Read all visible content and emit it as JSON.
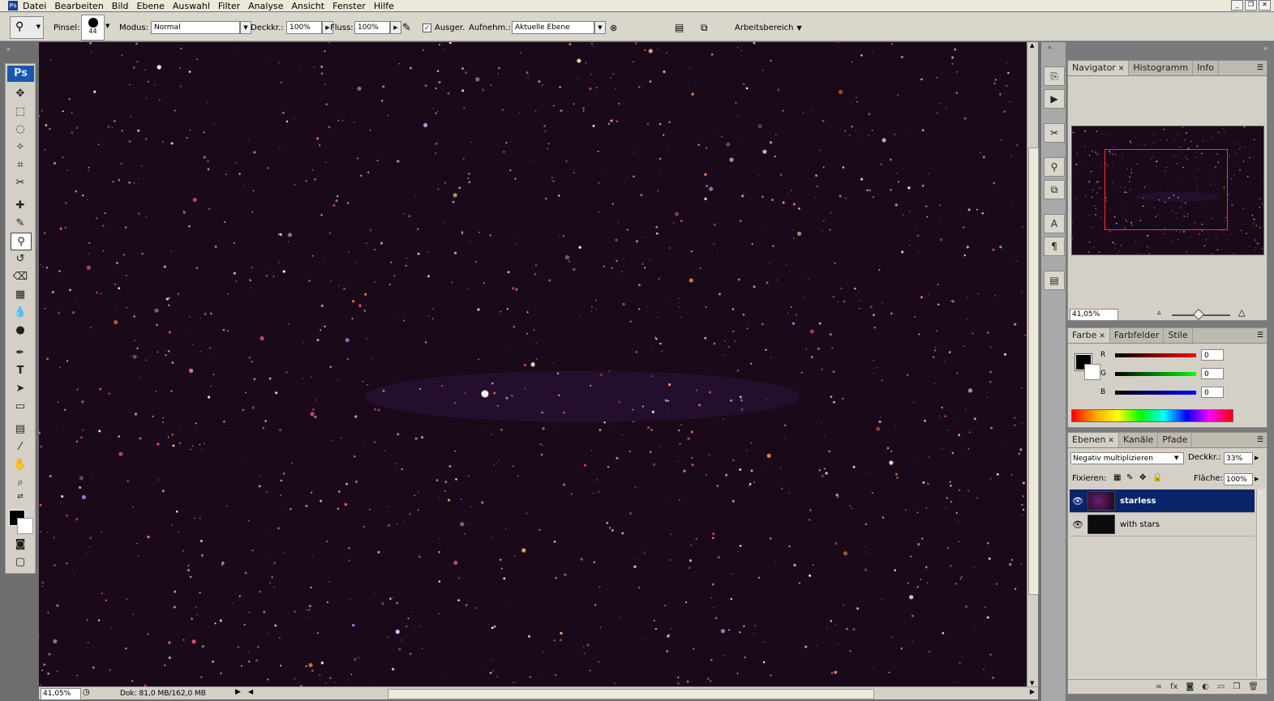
{
  "menu": [
    "Datei",
    "Bearbeiten",
    "Bild",
    "Ebene",
    "Auswahl",
    "Filter",
    "Analyse",
    "Ansicht",
    "Fenster",
    "Hilfe"
  ],
  "options": {
    "brush_label": "Pinsel:",
    "brush_size": "44",
    "mode_label": "Modus:",
    "mode_value": "Normal",
    "opacity_label": "Deckkr.:",
    "opacity_value": "100%",
    "flow_label": "Fluss:",
    "flow_value": "100%",
    "aligned_label": "Ausger.",
    "sample_label": "Aufnehm.:",
    "sample_value": "Aktuelle Ebene",
    "workspace_label": "Arbeitsbereich"
  },
  "status": {
    "zoom": "41,05%",
    "doc": "Dok: 81,0 MB/162,0 MB"
  },
  "navigator": {
    "tabs": [
      "Navigator",
      "Histogramm",
      "Info"
    ],
    "zoom": "41,05%"
  },
  "color_panel": {
    "tabs": [
      "Farbe",
      "Farbfelder",
      "Stile"
    ],
    "channels": [
      {
        "label": "R",
        "value": "0",
        "color": "#cc0000"
      },
      {
        "label": "G",
        "value": "0",
        "color": "#00a000"
      },
      {
        "label": "B",
        "value": "0",
        "color": "#0000cc"
      }
    ]
  },
  "layers_panel": {
    "tabs": [
      "Ebenen",
      "Kanäle",
      "Pfade"
    ],
    "blend_mode": "Negativ multiplizieren",
    "opacity_label": "Deckkr.:",
    "opacity_value": "33%",
    "lock_label": "Fixieren:",
    "fill_label": "Fläche:",
    "fill_value": "100%",
    "layers": [
      {
        "name": "starless",
        "selected": true
      },
      {
        "name": "with stars",
        "selected": false
      }
    ]
  },
  "colors": {
    "canvas_bg": "#1a0918",
    "selection": "#0a246a"
  }
}
